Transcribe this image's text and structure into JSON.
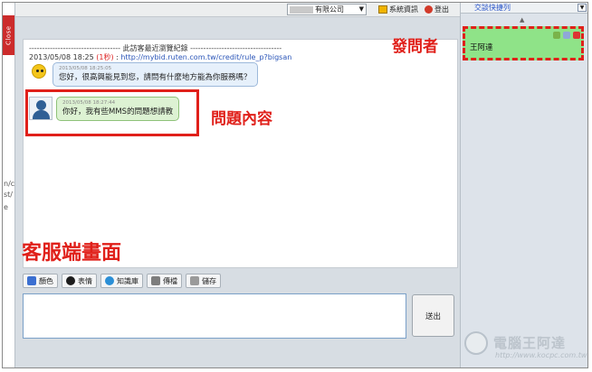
{
  "close_tab": "Close",
  "left_strip_fragments": [
    "n/c",
    "st/",
    "e"
  ],
  "topbar": {
    "company": "有限公司",
    "system_info": "系統資訊",
    "logout": "登出"
  },
  "history": {
    "header": "----------------------------------- 此訪客最近瀏覽紀錄 -----------------------------------",
    "date": "2013/05/08 18:25",
    "tag": "(1秒)",
    "link": "http://mybid.ruten.com.tw/credit/rule_p?bigsan"
  },
  "messages": [
    {
      "time": "2013/05/08 18:25:05",
      "text": "您好，很高興能見到您，請問有什麼地方能為你服務嗎？"
    },
    {
      "time": "2013/05/08 18:27:44",
      "text": "你好，我有些MMS的問題想請教"
    }
  ],
  "toolbar": {
    "buttons": [
      {
        "label": "顏色",
        "icon": "font-color-icon",
        "color": "#3b6fd1"
      },
      {
        "label": "表情",
        "icon": "emoticon-icon",
        "color": "#1c1c1c"
      },
      {
        "label": "知識庫",
        "icon": "help-icon",
        "color": "#2b8fd6"
      },
      {
        "label": "傳檔",
        "icon": "attach-icon",
        "color": "#7d7d7d"
      },
      {
        "label": "儲存",
        "icon": "save-icon",
        "color": "#9a9a9a"
      }
    ]
  },
  "send_button": "送出",
  "right_panel": {
    "title": "交談快捷列",
    "asker_name": "王阿達"
  },
  "annotations": {
    "asker": "發問者",
    "question": "問題內容",
    "screen": "客服端畫面"
  },
  "watermark": {
    "title": "電腦王阿達",
    "url": "http://www.kocpc.com.tw"
  },
  "colors": {
    "accent_red": "#e0201a",
    "user_bubble": "#ddf2d3",
    "bot_bubble": "#e6f0fb",
    "asker_card": "#8fe388",
    "link_blue": "#2a55b8"
  }
}
